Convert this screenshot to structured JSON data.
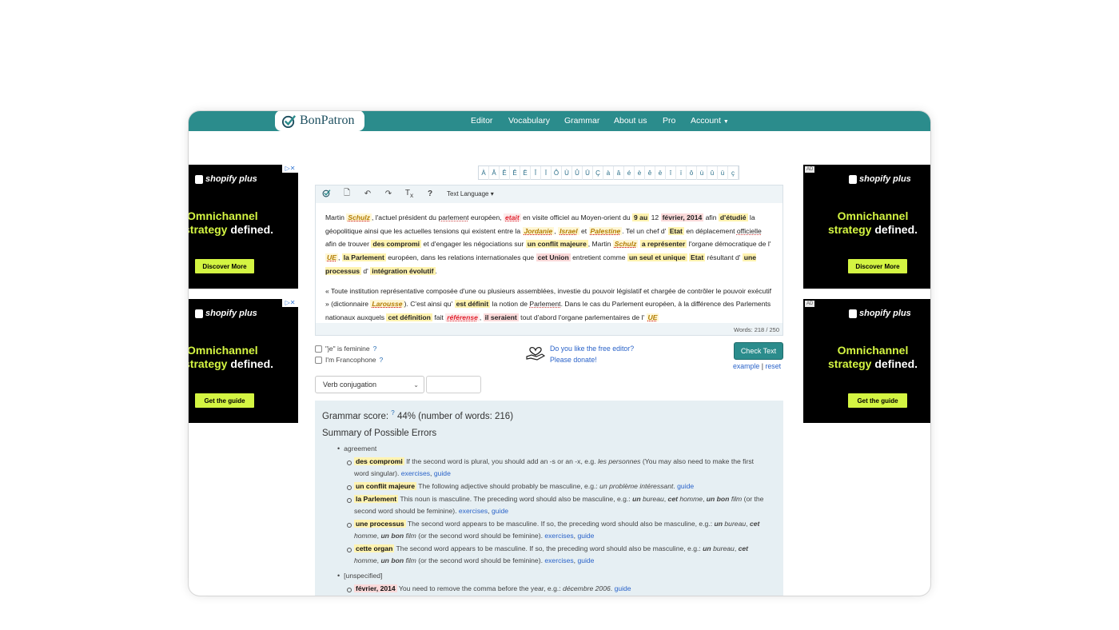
{
  "app": {
    "logo_text": "BonPatron"
  },
  "nav": {
    "items": [
      "Editor",
      "Vocabulary",
      "Grammar",
      "About us",
      "Pro",
      "Account"
    ]
  },
  "ads": [
    {
      "brand": "shopify plus",
      "line1": "Omnichannel",
      "line2a": "strategy",
      "line2b": "defined.",
      "button": "Discover More",
      "label": "AD"
    },
    {
      "brand": "shopify plus",
      "line1": "Omnichannel",
      "line2a": "strategy",
      "line2b": "defined.",
      "button": "Get the guide",
      "label": "AD"
    }
  ],
  "charbar": [
    "À",
    "Â",
    "Ê",
    "Ê",
    "Ë",
    "Î",
    "Ï",
    "Ô",
    "Ù",
    "Û",
    "Ü",
    "Ç",
    "à",
    "â",
    "é",
    "è",
    "ê",
    "ë",
    "î",
    "ï",
    "ô",
    "ù",
    "û",
    "ü",
    "ç"
  ],
  "toolbar": {
    "text_language": "Text Language"
  },
  "wordcount": "Words: 218 / 250",
  "options": {
    "feminine": "\"je\" is feminine",
    "francophone": "I'm Francophone",
    "q": "?"
  },
  "donate": {
    "line1": "Do you like the free editor?",
    "line2": "Please donate!"
  },
  "check_button": "Check Text",
  "links": {
    "example": "example",
    "sep": "|",
    "reset": "reset"
  },
  "verb_select": "Verb conjugation",
  "results": {
    "score_label": "Grammar score:",
    "score_q": "?",
    "score_value": "44% (number of words: 216)",
    "summary_title": "Summary of Possible Errors",
    "cat1": "agreement",
    "cat2": "[unspecified]"
  }
}
